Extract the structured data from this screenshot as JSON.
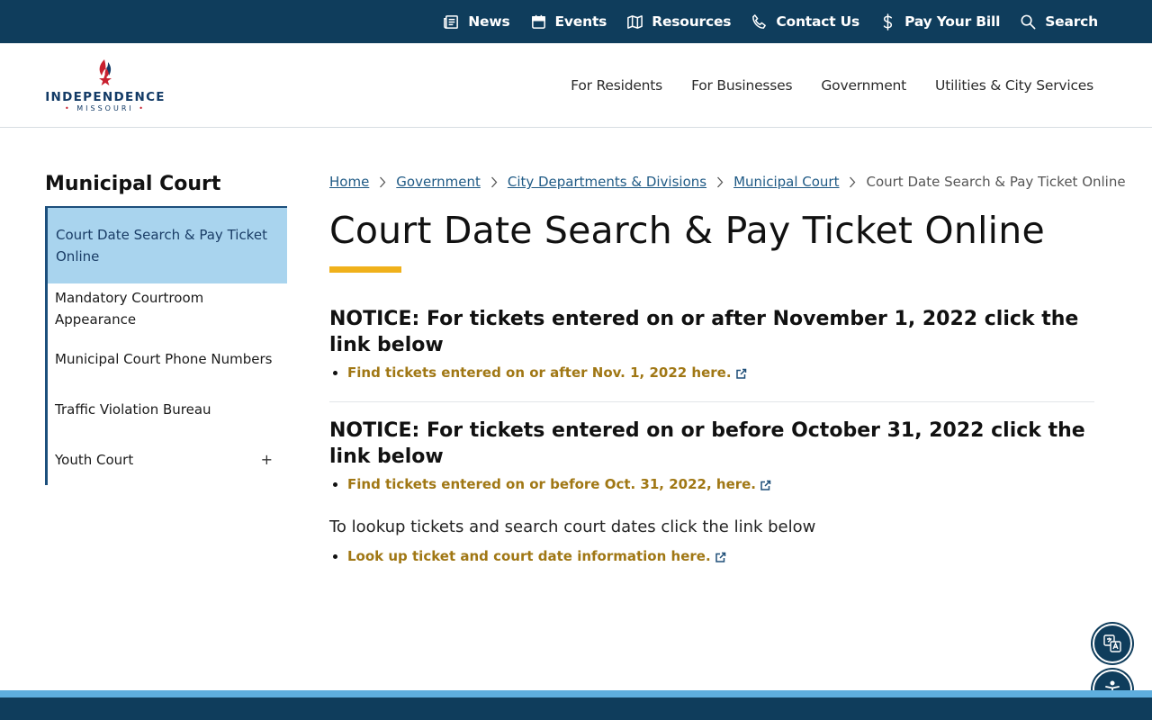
{
  "utility_nav": [
    {
      "label": "News",
      "icon": "newspaper-icon"
    },
    {
      "label": "Events",
      "icon": "calendar-icon"
    },
    {
      "label": "Resources",
      "icon": "map-icon"
    },
    {
      "label": "Contact Us",
      "icon": "phone-icon"
    },
    {
      "label": "Pay Your Bill",
      "icon": "dollar-icon"
    },
    {
      "label": "Search",
      "icon": "search-icon"
    }
  ],
  "logo": {
    "name": "INDEPENDENCE",
    "sub": "MISSOURI"
  },
  "main_nav": [
    "For Residents",
    "For Businesses",
    "Government",
    "Utilities & City Services"
  ],
  "sidebar": {
    "title": "Municipal Court",
    "items": [
      {
        "label": "Court Date Search & Pay Ticket Online",
        "active": true
      },
      {
        "label": "Mandatory Courtroom Appearance"
      },
      {
        "label": "Municipal Court Phone Numbers"
      },
      {
        "label": "Traffic Violation Bureau"
      },
      {
        "label": "Youth Court",
        "expand": "+"
      }
    ]
  },
  "breadcrumb": {
    "links": [
      "Home",
      "Government",
      "City Departments & Divisions",
      "Municipal Court"
    ],
    "current": "Court Date Search & Pay Ticket Online"
  },
  "page_title": "Court Date Search & Pay Ticket Online",
  "content": {
    "notice1": {
      "heading": "NOTICE: For tickets entered on or after November 1, 2022 click the link below",
      "link": "Find tickets entered on or after Nov. 1, 2022 here."
    },
    "notice2": {
      "heading": "NOTICE: For tickets entered on or before October 31, 2022 click the link below",
      "link": "Find tickets entered on or before Oct. 31, 2022, here."
    },
    "lookup_text": "To lookup tickets and search court dates click the link below",
    "lookup_link": "Look up ticket and court date information here."
  },
  "colors": {
    "navy": "#0f3d5c",
    "active_bg": "#a9d4ee",
    "accent_gold": "#f0b11b",
    "link_gold": "#a07714",
    "footer_light": "#5eaede"
  }
}
